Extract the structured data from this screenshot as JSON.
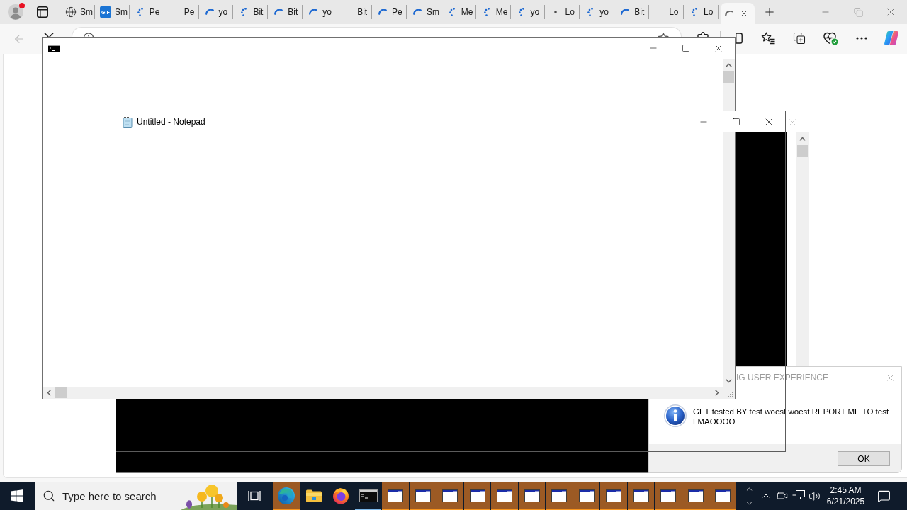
{
  "browser": {
    "profile": {
      "notification": true
    },
    "tabs": [
      {
        "label": "Sm",
        "kind": "globe",
        "selected": false
      },
      {
        "label": "Sm",
        "kind": "gif",
        "badge": "GIF",
        "selected": false
      },
      {
        "label": "Pe",
        "kind": "dots",
        "selected": false
      },
      {
        "label": "Pe",
        "kind": "blank",
        "selected": false
      },
      {
        "label": "yo",
        "kind": "spinner",
        "selected": false
      },
      {
        "label": "Bit",
        "kind": "dots",
        "selected": false
      },
      {
        "label": "Bit",
        "kind": "spinner",
        "selected": false
      },
      {
        "label": "yo",
        "kind": "spinner",
        "selected": false
      },
      {
        "label": "Bit",
        "kind": "blank",
        "selected": false
      },
      {
        "label": "Pe",
        "kind": "spinner",
        "selected": false
      },
      {
        "label": "Sm",
        "kind": "spinner",
        "selected": false
      },
      {
        "label": "Me",
        "kind": "dots",
        "selected": false
      },
      {
        "label": "Me",
        "kind": "dots",
        "selected": false
      },
      {
        "label": "yo",
        "kind": "dots",
        "selected": false
      },
      {
        "label": "Lo",
        "kind": "dot",
        "selected": false
      },
      {
        "label": "yo",
        "kind": "dots",
        "selected": false
      },
      {
        "label": "Bit",
        "kind": "spinner",
        "selected": false
      },
      {
        "label": "Lo",
        "kind": "blank",
        "selected": false
      },
      {
        "label": "Lo",
        "kind": "dots",
        "selected": false
      },
      {
        "kind": "spinner",
        "selected": true
      }
    ],
    "toolbar": {
      "back_disabled": true
    }
  },
  "notepad": {
    "title": "Untitled - Notepad"
  },
  "message_box": {
    "title": "IG USER EXPERIENCE",
    "message": "GET tested BY test woest woest REPORT ME TO test LMAOOOO",
    "button": "OK"
  },
  "taskbar": {
    "search": {
      "placeholder": "Type here to search"
    },
    "apps": [
      {
        "kind": "edge",
        "flashing": true,
        "open": true
      },
      {
        "kind": "explorer",
        "flashing": false,
        "open": false
      },
      {
        "kind": "firefox",
        "flashing": false,
        "open": false
      },
      {
        "kind": "cmd",
        "flashing": false,
        "open": true
      },
      {
        "kind": "window",
        "flashing": true,
        "open": true
      },
      {
        "kind": "window",
        "flashing": true,
        "open": true
      },
      {
        "kind": "window",
        "flashing": true,
        "open": true
      },
      {
        "kind": "window",
        "flashing": true,
        "open": true
      },
      {
        "kind": "window",
        "flashing": true,
        "open": true
      },
      {
        "kind": "window",
        "flashing": true,
        "open": true
      },
      {
        "kind": "window",
        "flashing": true,
        "open": true
      },
      {
        "kind": "window",
        "flashing": true,
        "open": true
      },
      {
        "kind": "window",
        "flashing": true,
        "open": true
      },
      {
        "kind": "window",
        "flashing": true,
        "open": true
      },
      {
        "kind": "window",
        "flashing": true,
        "open": true
      },
      {
        "kind": "window",
        "flashing": true,
        "open": true
      },
      {
        "kind": "window",
        "flashing": true,
        "open": true
      }
    ],
    "clock": {
      "time": "2:45 AM",
      "date": "6/21/2025"
    }
  }
}
